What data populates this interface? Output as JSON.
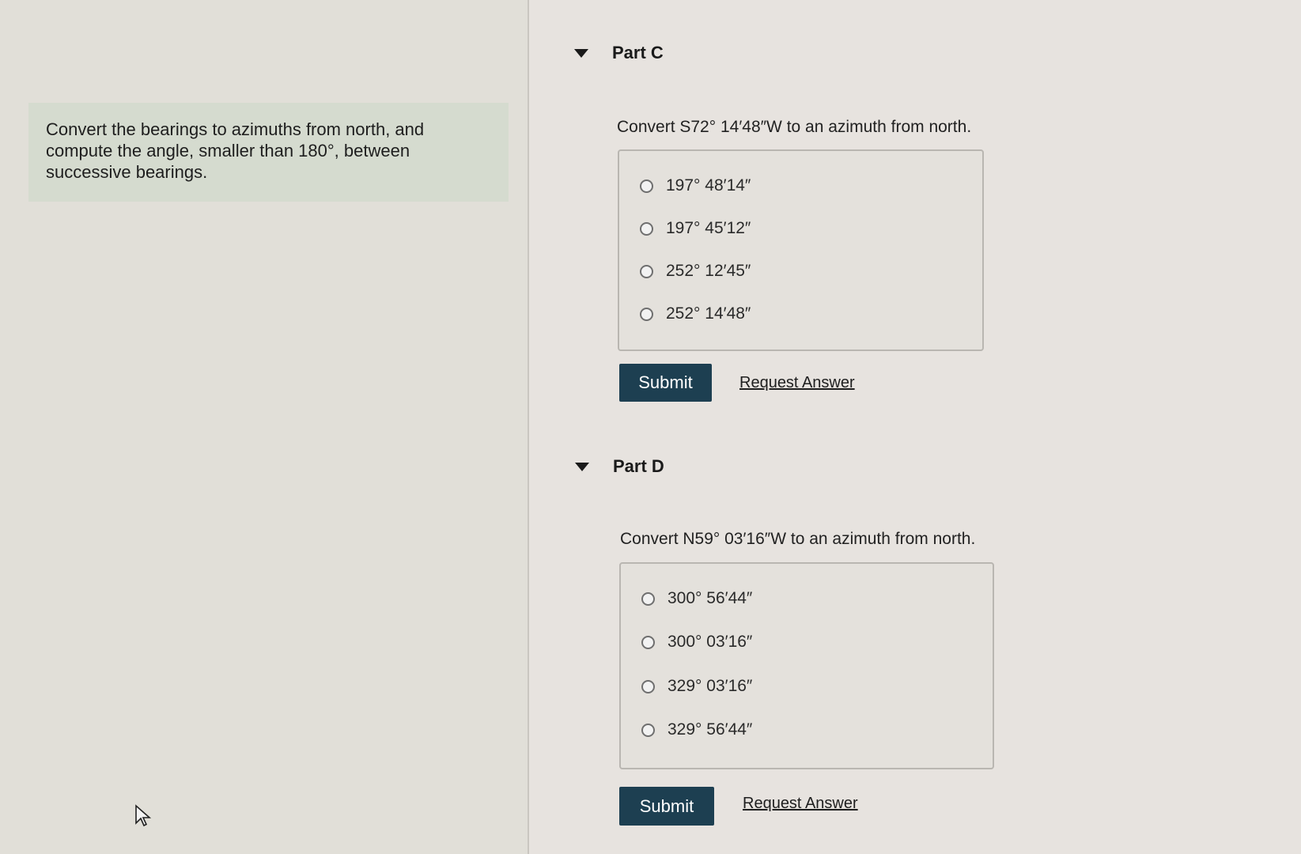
{
  "intro": {
    "text": "Convert the bearings to azimuths from north, and compute the angle, smaller than 180°, between successive bearings."
  },
  "partC": {
    "title": "Part C",
    "question": "Convert S72° 14′48″W to an azimuth from north.",
    "options": [
      "197° 48′14″",
      "197° 45′12″",
      "252° 12′45″",
      "252° 14′48″"
    ],
    "submit_label": "Submit",
    "request_label": "Request Answer"
  },
  "partD": {
    "title": "Part D",
    "question": "Convert N59° 03′16″W to an azimuth from north.",
    "options": [
      "300° 56′44″",
      "300° 03′16″",
      "329° 03′16″",
      "329° 56′44″"
    ],
    "submit_label": "Submit",
    "request_label": "Request Answer"
  },
  "icons": {
    "caret": "caret-down-icon",
    "cursor": "mouse-pointer-icon"
  },
  "colors": {
    "submit_bg": "#1d3f51",
    "intro_bg": "#d5dbcf"
  }
}
